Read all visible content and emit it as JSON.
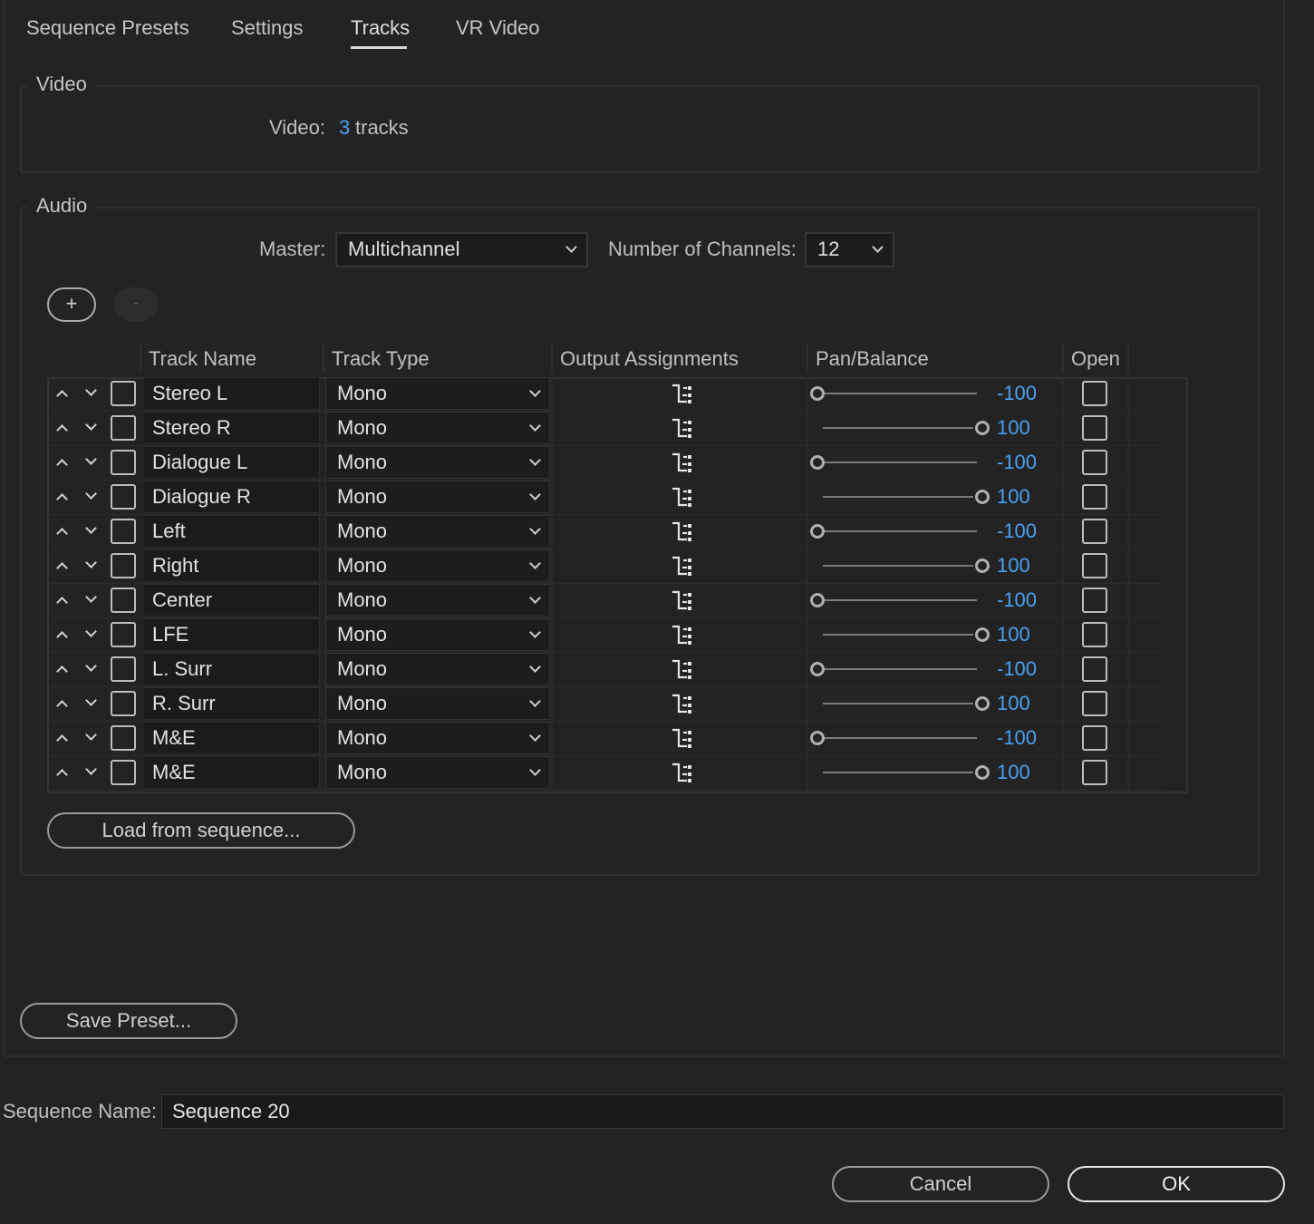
{
  "tabs": [
    {
      "label": "Sequence Presets",
      "active": false
    },
    {
      "label": "Settings",
      "active": false
    },
    {
      "label": "Tracks",
      "active": true
    },
    {
      "label": "VR Video",
      "active": false
    }
  ],
  "video": {
    "legend": "Video",
    "label": "Video:",
    "count": "3",
    "unit": "tracks"
  },
  "audio": {
    "legend": "Audio",
    "master_label": "Master:",
    "master_value": "Multichannel",
    "channels_label": "Number of Channels:",
    "channels_value": "12",
    "add_label": "+",
    "remove_label": "-",
    "columns": {
      "track_name": "Track Name",
      "track_type": "Track Type",
      "output": "Output Assignments",
      "pan": "Pan/Balance",
      "open": "Open"
    },
    "tracks": [
      {
        "name": "Stereo L",
        "type": "Mono",
        "pan": "-100"
      },
      {
        "name": "Stereo R",
        "type": "Mono",
        "pan": "100"
      },
      {
        "name": "Dialogue L",
        "type": "Mono",
        "pan": "-100"
      },
      {
        "name": "Dialogue R",
        "type": "Mono",
        "pan": "100"
      },
      {
        "name": "Left",
        "type": "Mono",
        "pan": "-100"
      },
      {
        "name": "Right",
        "type": "Mono",
        "pan": "100"
      },
      {
        "name": "Center",
        "type": "Mono",
        "pan": "-100"
      },
      {
        "name": "LFE",
        "type": "Mono",
        "pan": "100"
      },
      {
        "name": "L. Surr",
        "type": "Mono",
        "pan": "-100"
      },
      {
        "name": "R. Surr",
        "type": "Mono",
        "pan": "100"
      },
      {
        "name": "M&E",
        "type": "Mono",
        "pan": "-100"
      },
      {
        "name": "M&E",
        "type": "Mono",
        "pan": "100"
      }
    ],
    "load_button": "Load from sequence..."
  },
  "save_preset_button": "Save Preset...",
  "sequence_name": {
    "label": "Sequence Name:",
    "value": "Sequence 20"
  },
  "buttons": {
    "cancel": "Cancel",
    "ok": "OK"
  },
  "colors": {
    "background": "#232323",
    "accent_value": "#4aa0f0"
  },
  "icons": {
    "add": "plus-icon",
    "remove": "minus-icon",
    "move_up": "chevron-up-icon",
    "move_down": "chevron-down-icon",
    "output": "output-assignment-icon",
    "pan_knob": "pan-knob-icon"
  }
}
